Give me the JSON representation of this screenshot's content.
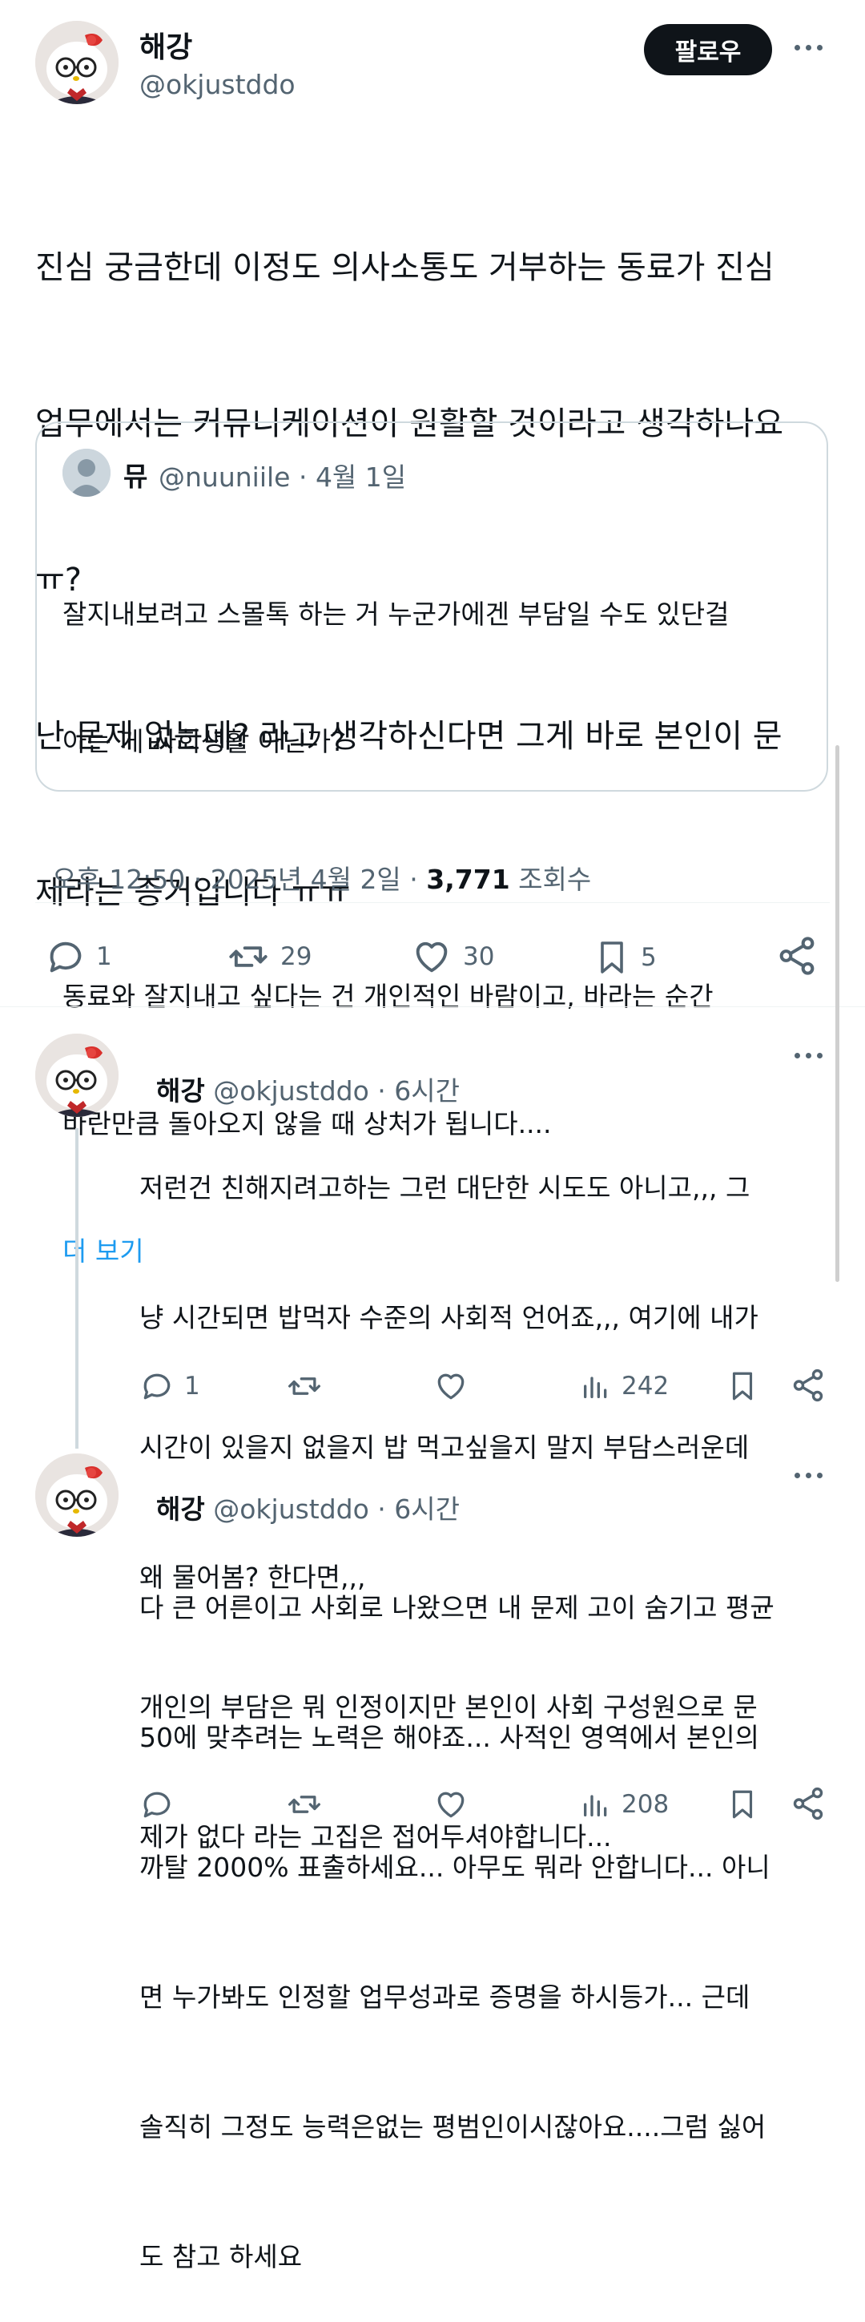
{
  "main_post": {
    "author_name": "해강",
    "handle": "@okjustddo",
    "follow_label": "팔로우",
    "text_lines": [
      "진심 궁금한데 이정도 의사소통도 거부하는 동료가 진심",
      "업무에서는 커뮤니케이션이 원활할 것이라고 생각하나요",
      "ㅠ?",
      "난 문제 없는데? 라고 생각하신다면 그게 바로 본인이 문",
      "제라는 증거입니다 ㅠㅠ"
    ],
    "quote": {
      "author_name": "뮤",
      "meta": "@nuuniile · 4월 1일",
      "lines": [
        "잘지내보려고 스몰톡 하는 거 누군가에겐 부담일 수도 있단걸",
        "아는 게 사회생활 아닌가?",
        "",
        "동료와 잘지내고 싶다는 건 개인적인 바람이고, 바라는 순간",
        "바란만큼 돌아오지 않을 때 상처가 됩니다...."
      ],
      "more_label": "더 보기"
    },
    "timestamp": "오후 12:50 · 2025년 4월 2일 · ",
    "views_count": "3,771",
    "views_label": " 조회수",
    "stats": {
      "replies": "1",
      "reposts": "29",
      "likes": "30",
      "bookmarks": "5"
    }
  },
  "replies": [
    {
      "author_name": "해강",
      "meta": "@okjustddo · 6시간",
      "lines": [
        "저런건 친해지려고하는 그런 대단한 시도도 아니고,,, 그",
        "냥 시간되면 밥먹자 수준의 사회적 언어죠,,, 여기에 내가",
        "시간이 있을지 없을지 밥 먹고싶을지 말지 부담스러운데",
        "왜 물어봄? 한다면,,,",
        "개인의 부담은 뭐 인정이지만 본인이 사회 구성원으로 문",
        "제가 없다 라는 고집은 접어두셔야합니다..."
      ],
      "reply_count": "1",
      "repost_count": "",
      "like_count": "",
      "views": "242"
    },
    {
      "author_name": "해강",
      "meta": "@okjustddo · 6시간",
      "lines": [
        "다 큰 어른이고 사회로 나왔으면 내 문제 고이 숨기고 평균",
        "50에 맞추려는 노력은 해야죠... 사적인 영역에서 본인의",
        "까탈 2000% 표출하세요... 아무도 뭐라 안합니다... 아니",
        "면 누가봐도 인정할 업무성과로 증명을 하시등가... 근데",
        "솔직히 그정도 능력은없는 평범인이시잖아요....그럼 싫어",
        "도 참고 하세요"
      ],
      "reply_count": "",
      "repost_count": "",
      "like_count": "",
      "views": "208"
    }
  ],
  "icons": {
    "reply": "speech-bubble-icon",
    "repost": "repost-arrows-icon",
    "like": "heart-icon",
    "bookmark": "bookmark-icon",
    "share": "share-icon",
    "views": "bar-chart-icon",
    "more": "more-dots-icon"
  },
  "colors": {
    "text": "#0f1419",
    "secondary": "#536471",
    "link": "#1d9bf0",
    "border": "#cfd9de",
    "follow_bg": "#0f1419"
  }
}
